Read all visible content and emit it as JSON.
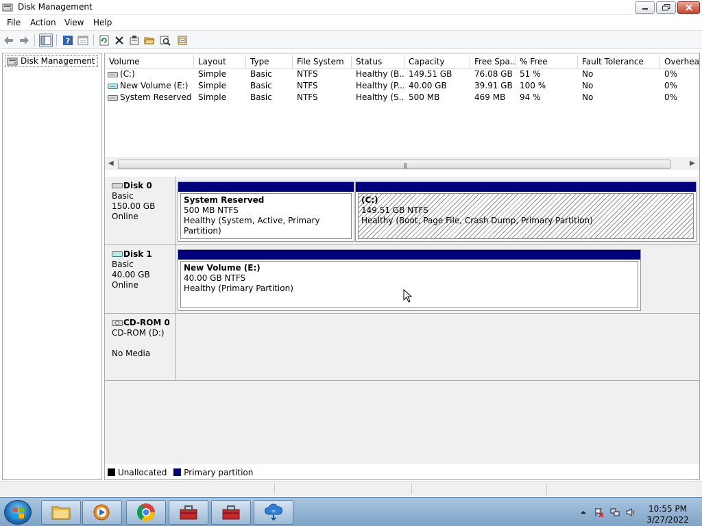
{
  "window": {
    "title": "Disk Management",
    "icon": "disk-management-icon"
  },
  "menu": [
    "File",
    "Action",
    "View",
    "Help"
  ],
  "toolbar": {
    "icons": [
      "back-arrow-icon",
      "forward-arrow-icon",
      "show-hide-console-tree-icon",
      "help-icon",
      "properties-view-icon",
      "refresh-icon",
      "delete-icon",
      "properties-icon",
      "open-icon",
      "rescan-icon",
      "more-actions-icon"
    ]
  },
  "tree": {
    "root_label": "Disk Management"
  },
  "volume_table": {
    "columns": [
      "Volume",
      "Layout",
      "Type",
      "File System",
      "Status",
      "Capacity",
      "Free Spa...",
      "% Free",
      "Fault Tolerance",
      "Overhead"
    ],
    "rows": [
      {
        "volume": "(C:)",
        "layout": "Simple",
        "type": "Basic",
        "fs": "NTFS",
        "status": "Healthy (B...",
        "capacity": "149.51 GB",
        "free": "76.08 GB",
        "pct_free": "51 %",
        "fault": "No",
        "overhead": "0%"
      },
      {
        "volume": "New Volume (E:)",
        "layout": "Simple",
        "type": "Basic",
        "fs": "NTFS",
        "status": "Healthy (P...",
        "capacity": "40.00 GB",
        "free": "39.91 GB",
        "pct_free": "100 %",
        "fault": "No",
        "overhead": "0%"
      },
      {
        "volume": "System Reserved",
        "layout": "Simple",
        "type": "Basic",
        "fs": "NTFS",
        "status": "Healthy (S...",
        "capacity": "500 MB",
        "free": "469 MB",
        "pct_free": "94 %",
        "fault": "No",
        "overhead": "0%"
      }
    ]
  },
  "disks": [
    {
      "name": "Disk 0",
      "type": "Basic",
      "size": "150.00 GB",
      "state": "Online",
      "partitions": [
        {
          "name": "System Reserved",
          "size": "500 MB NTFS",
          "status": "Healthy (System, Active, Primary Partition)"
        },
        {
          "name": "(C:)",
          "size": "149.51 GB NTFS",
          "status": "Healthy (Boot, Page File, Crash Dump, Primary Partition)"
        }
      ]
    },
    {
      "name": "Disk 1",
      "type": "Basic",
      "size": "40.00 GB",
      "state": "Online",
      "partitions": [
        {
          "name": "New Volume  (E:)",
          "size": "40.00 GB NTFS",
          "status": "Healthy (Primary Partition)"
        }
      ]
    },
    {
      "name": "CD-ROM 0",
      "type": "CD-ROM (D:)",
      "state": "No Media"
    }
  ],
  "legend": {
    "unallocated": "Unallocated",
    "primary": "Primary partition",
    "unallocated_color": "#000000",
    "primary_color": "#00007f"
  },
  "taskbar": {
    "apps": [
      "file-explorer-icon",
      "media-player-icon",
      "chrome-icon",
      "toolbox-icon",
      "toolbox-icon",
      "cloud-download-icon"
    ],
    "clock_time": "10:55 PM",
    "clock_date": "3/27/2022"
  }
}
